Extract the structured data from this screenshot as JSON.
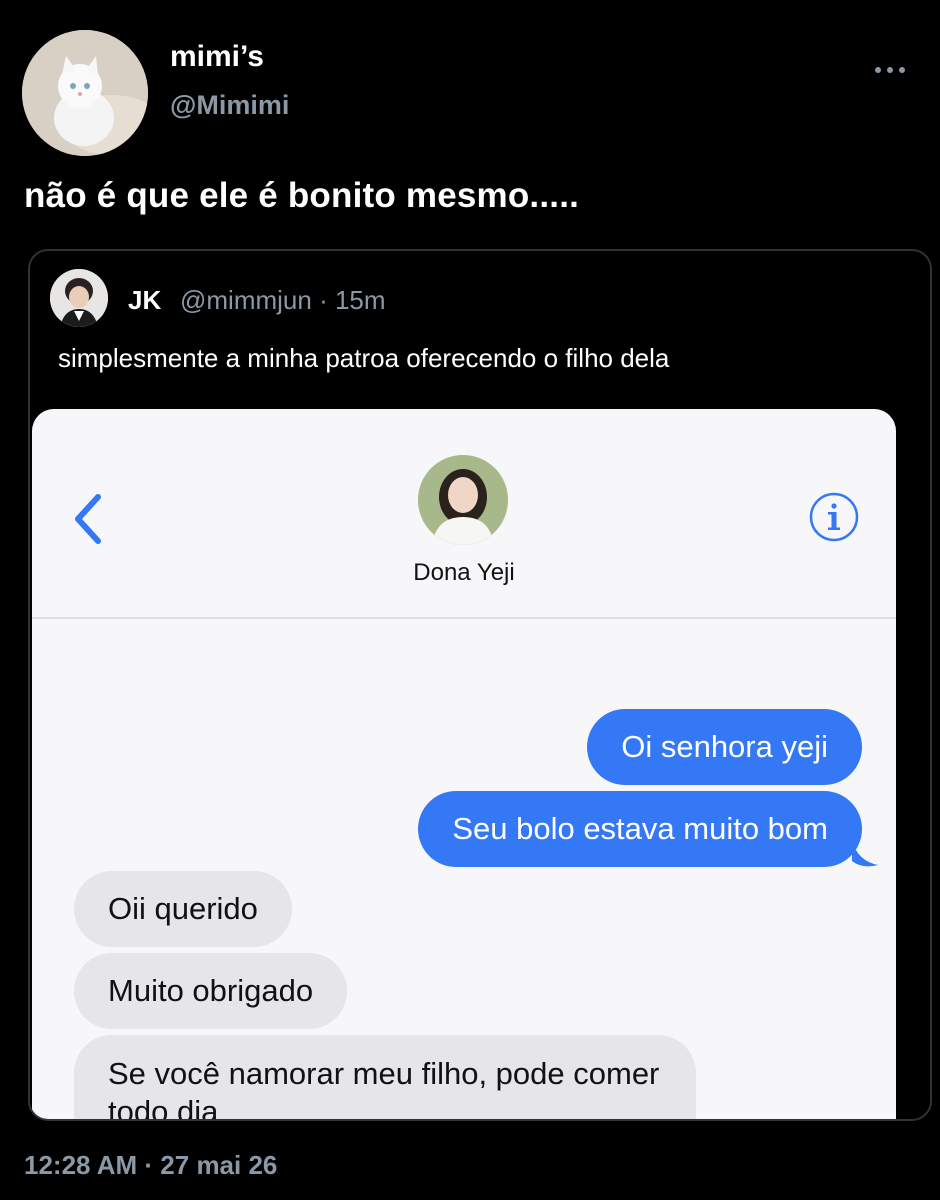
{
  "author": {
    "display_name": "mimi’s",
    "handle": "@Mimimi"
  },
  "tweet": {
    "text": "não é que ele é bonito mesmo.....",
    "timestamp": "12:28 AM · 27 mai 26"
  },
  "icons": {
    "more": "more-horizontal-icon",
    "back": "chevron-left-icon",
    "info": "info-circle-icon"
  },
  "quoted": {
    "name": "JK",
    "meta": "@mimmjun · 15m",
    "text": "simplesmente a minha patroa oferecendo o filho dela",
    "screenshot": {
      "contact_name": "Dona Yeji",
      "messages": [
        {
          "from": "me",
          "text": "Oi senhora yeji"
        },
        {
          "from": "me",
          "text": "Seu bolo estava muito bom"
        },
        {
          "from": "them",
          "text": "Oii querido"
        },
        {
          "from": "them",
          "text": "Muito obrigado"
        },
        {
          "from": "them",
          "text": "Se você namorar meu filho, pode comer todo dia"
        }
      ]
    }
  },
  "colors": {
    "background": "#000000",
    "muted": "#8b98a5",
    "imessage_blue": "#3478f6",
    "received_gray": "#e5e5ea"
  }
}
